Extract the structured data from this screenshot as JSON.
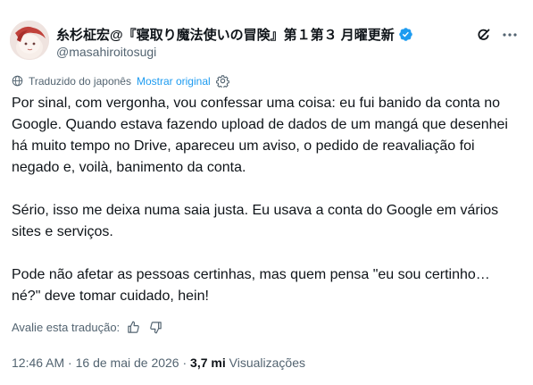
{
  "author": {
    "display_name": "糸杉柾宏@『寝取り魔法使いの冒険』第１第３ 月曜更新",
    "handle": "@masahiroitosugi",
    "verified": true
  },
  "translation": {
    "label": "Traduzido do japonês",
    "show_original": "Mostrar original"
  },
  "tweet": {
    "paragraphs": [
      "Por sinal, com vergonha, vou confessar uma coisa: eu fui banido da conta no Google. Quando estava fazendo upload de dados de um mangá que desenhei há muito tempo no Drive, apareceu um aviso, o pedido de reavaliação foi negado e, voilà, banimento da conta.",
      "Sério, isso me deixa numa saia justa. Eu usava a conta do Google em vários sites e serviços.",
      "Pode não afetar as pessoas certinhas, mas quem pensa \"eu sou certinho… né?\" deve tomar cuidado, hein!"
    ]
  },
  "rating": {
    "label": "Avalie esta tradução:"
  },
  "meta": {
    "time": "12:46 AM",
    "separator": "·",
    "date": "16 de mai de 2026",
    "views_count": "3,7 mi",
    "views_label": "Visualizações"
  },
  "colors": {
    "text": "#0f1419",
    "secondary": "#536471",
    "link": "#1d9bf0",
    "verified": "#1d9bf0"
  },
  "icons": {
    "verified": "verified-badge-icon",
    "grok": "grok-icon",
    "more": "more-icon",
    "translate": "globe-icon",
    "settings": "gear-icon",
    "thumbs_up": "thumbs-up-icon",
    "thumbs_down": "thumbs-down-icon"
  }
}
